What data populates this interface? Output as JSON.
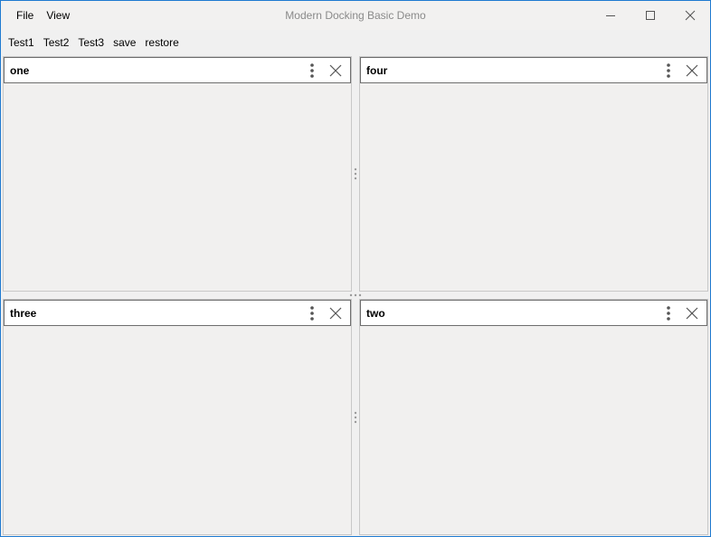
{
  "app": {
    "title": "Modern Docking Basic Demo",
    "menu": [
      {
        "label": "File"
      },
      {
        "label": "View"
      }
    ],
    "window_controls": {
      "minimize_icon": "minimize-icon",
      "maximize_icon": "maximize-icon",
      "close_icon": "close-icon"
    }
  },
  "toolbar": {
    "buttons": [
      {
        "label": "Test1"
      },
      {
        "label": "Test2"
      },
      {
        "label": "Test3"
      },
      {
        "label": "save"
      },
      {
        "label": "restore"
      }
    ]
  },
  "panels": [
    {
      "title": "one",
      "menu_icon": "vertical-dots-icon",
      "close_icon": "close-icon"
    },
    {
      "title": "four",
      "menu_icon": "vertical-dots-icon",
      "close_icon": "close-icon"
    },
    {
      "title": "three",
      "menu_icon": "vertical-dots-icon",
      "close_icon": "close-icon"
    },
    {
      "title": "two",
      "menu_icon": "vertical-dots-icon",
      "close_icon": "close-icon"
    }
  ],
  "colors": {
    "window_border": "#1f7ad0",
    "background": "#f0f0f0",
    "panel_header_border": "#6e6e6e",
    "title_text": "#8a8a8a"
  }
}
